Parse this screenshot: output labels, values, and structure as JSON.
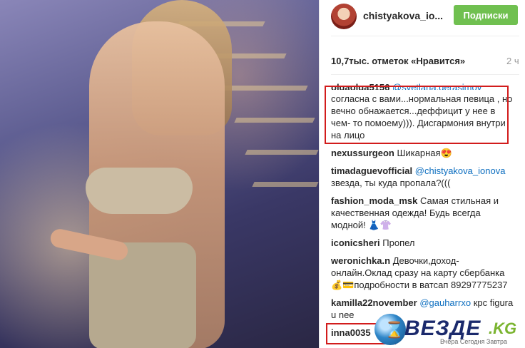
{
  "post": {
    "username": "chistyakova_io...",
    "follow_label": "Подписки",
    "likes": "10,7тыс. отметок «Нравится»",
    "time": "2 ч"
  },
  "comments": [
    {
      "user": "olgaolga5156",
      "mention": "@svetlana.gerasimov",
      "text": "согласна с вами...нормальная певица , но вечно обнажается...деффицит у нее в чем- то помоему))). Дисгармония внутри на лицо"
    },
    {
      "user": "nexussurgeon",
      "mention": "",
      "text": "Шикарная😍"
    },
    {
      "user": "timadaguevofficial",
      "mention": "@chistyakova_ionova",
      "text": "звезда, ты куда пропала?((("
    },
    {
      "user": "fashion_moda_msk",
      "mention": "",
      "text": "Самая стильная и качественная одежда! Будь всегда модной! 👗👚"
    },
    {
      "user": "iconicsheri",
      "mention": "",
      "text": "Пропел"
    },
    {
      "user": "weronichka.n",
      "mention": "",
      "text": "Девочки,доход-онлайн.Оклад сразу на карту сбербанка💰💳подробности в ватсап 89297775237"
    },
    {
      "user": "kamilla22november",
      "mention": "@gauharrxo",
      "text": "крс figura u nee"
    },
    {
      "user": "inna0035",
      "mention": "",
      "text": ""
    }
  ],
  "watermark": {
    "brand": "ВЕЗДЕ",
    "domain": ".KG",
    "tagline": "Вчера Сегодня Завтра"
  }
}
